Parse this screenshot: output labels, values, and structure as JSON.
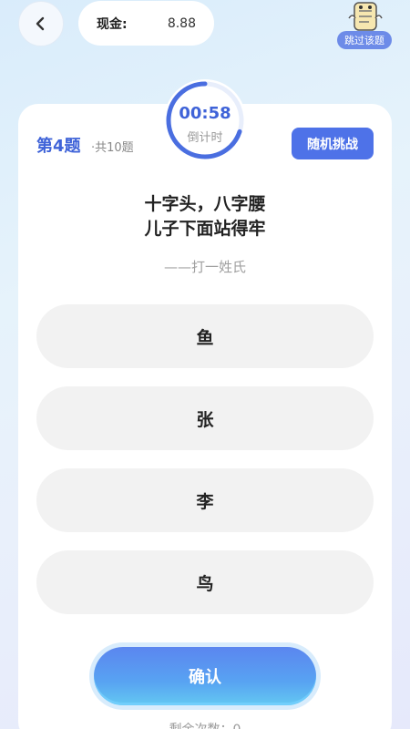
{
  "header": {
    "back_icon": "chevron-left-icon",
    "cash_label": "现金:",
    "cash_value": "8.88",
    "skip_label": "跳过该题",
    "skip_mascot_icon": "mascot-icon"
  },
  "timer": {
    "value": "00:58",
    "label": "倒计时",
    "progress_fraction": 0.7,
    "accent": "#3f63d8"
  },
  "question": {
    "number": "第4题",
    "total": "·共10题",
    "random_label": "随机挑战",
    "riddle_line1": "十字头，八字腰",
    "riddle_line2": "儿子下面站得牢",
    "hint": "——打一姓氏"
  },
  "options": [
    {
      "label": "鱼"
    },
    {
      "label": "张"
    },
    {
      "label": "李"
    },
    {
      "label": "鸟"
    }
  ],
  "confirm_label": "确认",
  "remaining_text": "剩余次数：0"
}
